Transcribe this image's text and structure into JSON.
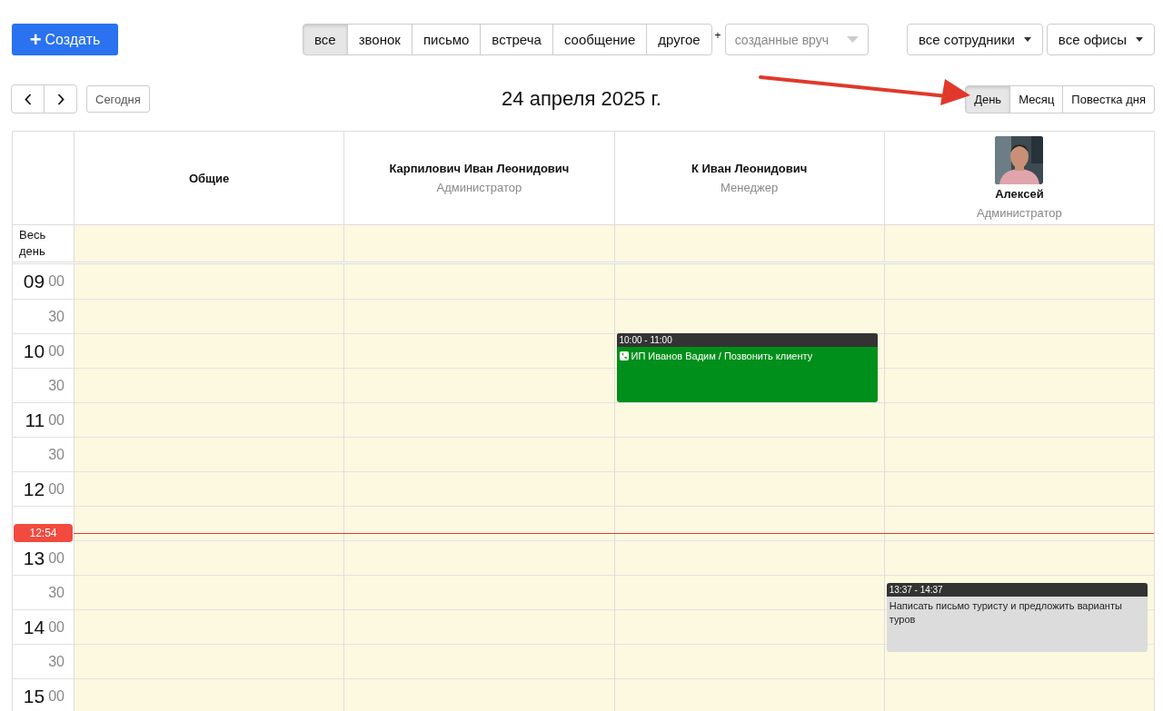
{
  "create_button": {
    "icon": "+",
    "label": "Создать"
  },
  "type_filters": [
    {
      "label": "все",
      "selected": true
    },
    {
      "label": "звонок",
      "selected": false
    },
    {
      "label": "письмо",
      "selected": false
    },
    {
      "label": "встреча",
      "selected": false
    },
    {
      "label": "сообщение",
      "selected": false
    },
    {
      "label": "другое",
      "selected": false
    }
  ],
  "plus_label": "+",
  "source_select": {
    "placeholder": "созданные вруч"
  },
  "employee_select": {
    "value": "все сотрудники"
  },
  "office_select": {
    "value": "все офисы"
  },
  "today_button": "Сегодня",
  "date_title": "24 апреля 2025 г.",
  "views": [
    {
      "label": "День",
      "selected": true
    },
    {
      "label": "Месяц",
      "selected": false
    },
    {
      "label": "Повестка дня",
      "selected": false
    }
  ],
  "columns": [
    {
      "name": "Общие"
    },
    {
      "name": "Карпилович Иван Леонидович",
      "role": "Администратор"
    },
    {
      "name": "К Иван Леонидович",
      "role": "Менеджер",
      "events": [
        {
          "time": "10:00 - 11:00",
          "title": "ИП Иванов Вадим / Позвонить клиенту",
          "kind": "call",
          "color": "#008f1a"
        }
      ]
    },
    {
      "name": "Алексей",
      "role": "Администратор",
      "events": [
        {
          "time": "13:37 - 14:37",
          "title": "Написать письмо туристу и предложить варианты туров",
          "kind": "task",
          "color": "#dcdcdc"
        }
      ]
    }
  ],
  "all_day_label": "Весь день",
  "time_slots": [
    {
      "kind": "hour",
      "hour": "09",
      "minute": "00"
    },
    {
      "kind": "half",
      "minute": "30"
    },
    {
      "kind": "hour",
      "hour": "10",
      "minute": "00"
    },
    {
      "kind": "half",
      "minute": "30"
    },
    {
      "kind": "hour",
      "hour": "11",
      "minute": "00"
    },
    {
      "kind": "half",
      "minute": "30"
    },
    {
      "kind": "hour",
      "hour": "12",
      "minute": "00"
    },
    {
      "kind": "half"
    },
    {
      "kind": "hour",
      "hour": "13",
      "minute": "00"
    },
    {
      "kind": "half",
      "minute": "30"
    },
    {
      "kind": "hour",
      "hour": "14",
      "minute": "00"
    },
    {
      "kind": "half",
      "minute": "30"
    },
    {
      "kind": "hour",
      "hour": "15",
      "minute": "00"
    }
  ],
  "now_marker": "12:54"
}
